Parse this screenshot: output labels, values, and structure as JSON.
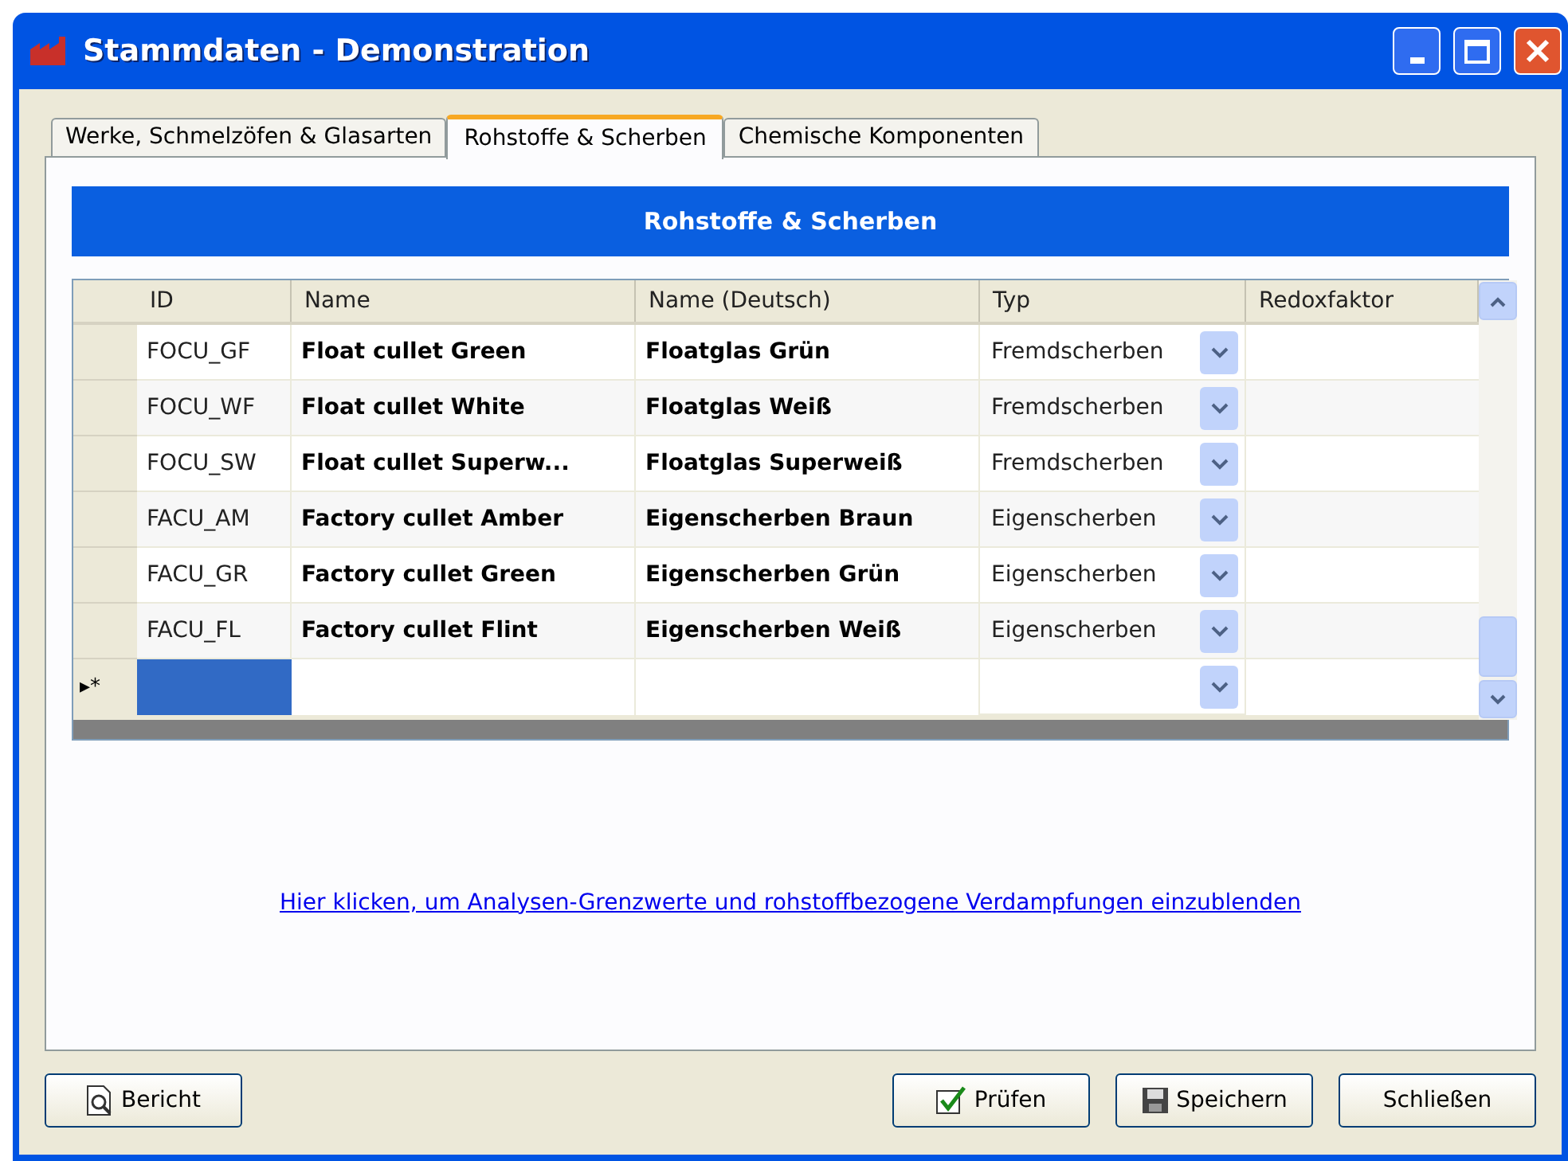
{
  "window": {
    "title": "Stammdaten - Demonstration"
  },
  "tabs": [
    {
      "label": "Werke, Schmelzöfen & Glasarten",
      "selected": false
    },
    {
      "label": "Rohstoffe & Scherben",
      "selected": true
    },
    {
      "label": "Chemische Komponenten",
      "selected": false
    }
  ],
  "banner": "Rohstoffe & Scherben",
  "table": {
    "columns": [
      "ID",
      "Name",
      "Name (Deutsch)",
      "Typ",
      "Redoxfaktor"
    ],
    "rows": [
      {
        "id": "FOCU_GF",
        "name": "Float cullet Green",
        "name_de": "Floatglas Grün",
        "typ": "Fremdscherben"
      },
      {
        "id": "FOCU_WF",
        "name": "Float cullet White",
        "name_de": "Floatglas Weiß",
        "typ": "Fremdscherben"
      },
      {
        "id": "FOCU_SW",
        "name": "Float cullet Superw...",
        "name_de": "Floatglas Superweiß",
        "typ": "Fremdscherben"
      },
      {
        "id": "FACU_AM",
        "name": "Factory cullet Amber",
        "name_de": "Eigenscherben Braun",
        "typ": "Eigenscherben"
      },
      {
        "id": "FACU_GR",
        "name": "Factory cullet Green",
        "name_de": "Eigenscherben Grün",
        "typ": "Eigenscherben"
      },
      {
        "id": "FACU_FL",
        "name": "Factory cullet Flint",
        "name_de": "Eigenscherben Weiß",
        "typ": "Eigenscherben"
      }
    ],
    "new_row": {
      "marker": "▸*",
      "selected": true
    }
  },
  "link": "Hier klicken, um Analysen-Grenzwerte und rohstoffbezogene Verdampfungen einzublenden",
  "buttons": [
    {
      "kind": "report",
      "label": "Bericht"
    },
    {
      "kind": "check",
      "label": "Prüfen"
    },
    {
      "kind": "save",
      "label": "Speichern"
    },
    {
      "kind": "close",
      "label": "Schließen"
    }
  ]
}
